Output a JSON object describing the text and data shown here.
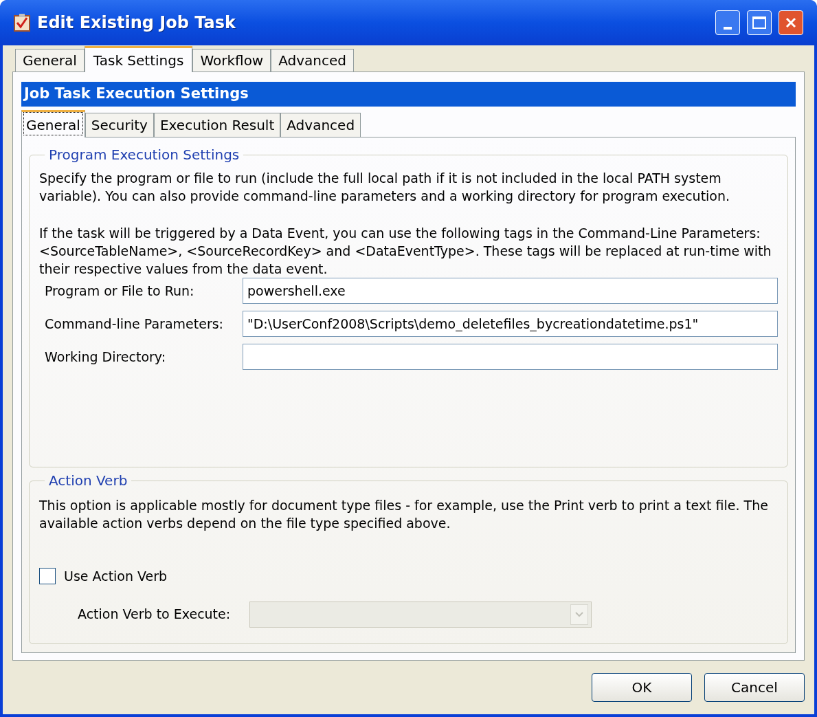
{
  "window": {
    "title": "Edit Existing Job Task"
  },
  "tabs": [
    {
      "label": "General",
      "selected": false
    },
    {
      "label": "Task Settings",
      "selected": true
    },
    {
      "label": "Workflow",
      "selected": false
    },
    {
      "label": "Advanced",
      "selected": false
    }
  ],
  "header": "Job Task Execution Settings",
  "subtabs": [
    {
      "label": "General",
      "selected": true
    },
    {
      "label": "Security",
      "selected": false
    },
    {
      "label": "Execution Result",
      "selected": false
    },
    {
      "label": "Advanced",
      "selected": false
    }
  ],
  "program_group": {
    "title": "Program Execution Settings",
    "paragraphs": [
      "Specify the program or file to run (include the full local path if it is not included in the local PATH system variable). You can also provide command-line parameters and a working directory for program execution.",
      "If the task will be triggered by a Data Event, you can use the following tags in the Command-Line Parameters: <SourceTableName>, <SourceRecordKey> and <DataEventType>. These tags will  be replaced at run-time with their respective values from the data event."
    ],
    "fields": [
      {
        "label": "Program or File to Run:",
        "value": "powershell.exe"
      },
      {
        "label": "Command-line Parameters:",
        "value": "\"D:\\UserConf2008\\Scripts\\demo_deletefiles_bycreationdatetime.ps1\""
      },
      {
        "label": "Working Directory:"
      }
    ]
  },
  "action_group": {
    "title": "Action Verb",
    "paragraph": "This option is applicable mostly for document type files - for example, use the Print verb to print a text file. The available action verbs depend on the file type specified above.",
    "checkbox": {
      "label": "Use Action Verb",
      "checked": false
    },
    "dropdown": {
      "label": "Action Verb to Execute:",
      "disabled": true
    }
  },
  "buttons": [
    "OK",
    "Cancel"
  ]
}
